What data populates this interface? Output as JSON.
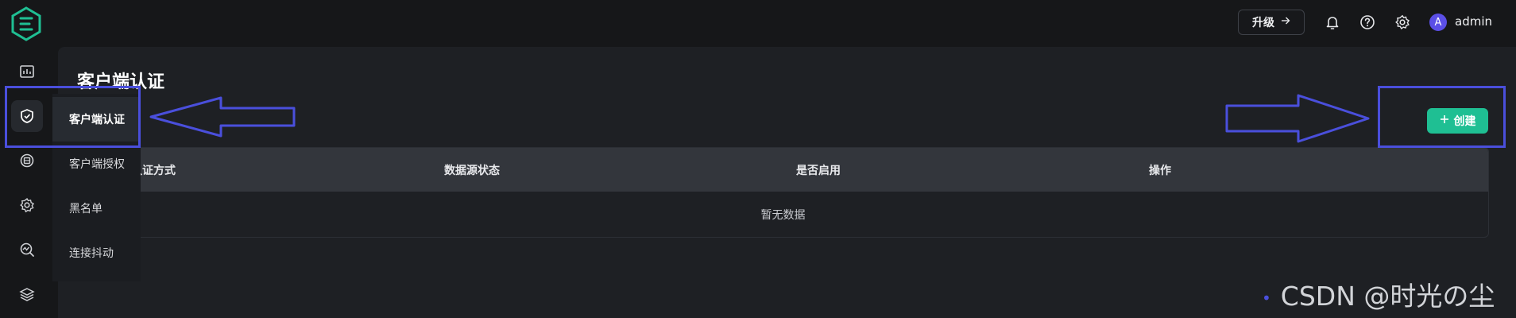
{
  "header": {
    "upgrade_label": "升级",
    "user_avatar_letter": "A",
    "username": "admin"
  },
  "submenu": {
    "items": [
      {
        "label": "客户端认证",
        "active": true
      },
      {
        "label": "客户端授权",
        "active": false
      },
      {
        "label": "黑名单",
        "active": false
      },
      {
        "label": "连接抖动",
        "active": false
      }
    ]
  },
  "page": {
    "title": "客户端认证",
    "create_label": "创建"
  },
  "table": {
    "columns": [
      "认证方式",
      "数据源状态",
      "是否启用",
      "操作"
    ],
    "empty_text": "暂无数据"
  },
  "watermark": "CSDN @时光の尘",
  "colors": {
    "accent": "#1fbf93",
    "annotation": "#4a4fdc",
    "avatar": "#5b4fe6"
  }
}
